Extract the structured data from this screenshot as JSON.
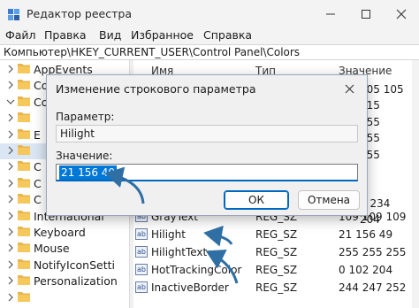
{
  "window": {
    "title": "Редактор реестра",
    "controls": [
      "minimize-icon",
      "maximize-icon",
      "close-icon"
    ]
  },
  "menu": [
    "Файл",
    "Правка",
    "Вид",
    "Избранное",
    "Справка"
  ],
  "address": "Компьютер\\HKEY_CURRENT_USER\\Control Panel\\Colors",
  "tree": [
    {
      "label": "AppEvents",
      "expanded": false
    },
    {
      "label": "Co",
      "expanded": false
    },
    {
      "label": "Co",
      "expanded": true
    },
    {
      "label": "",
      "expanded": false
    },
    {
      "label": "E",
      "expanded": false
    },
    {
      "label": "",
      "expanded": false,
      "selected": true
    },
    {
      "label": "C",
      "expanded": false
    },
    {
      "label": "C",
      "expanded": false
    },
    {
      "label": "C",
      "expanded": false
    },
    {
      "label": "International",
      "expanded": false
    },
    {
      "label": "Keyboard",
      "expanded": false
    },
    {
      "label": "Mouse",
      "expanded": false
    },
    {
      "label": "NotifyIconSetti",
      "expanded": false
    },
    {
      "label": "Personalization",
      "expanded": false
    },
    {
      "label": "",
      "expanded": false
    }
  ],
  "list": {
    "headers": {
      "name": "Имя",
      "type": "Тип",
      "value": "Значение"
    },
    "right_values": [
      "105 105",
      "215",
      "255",
      "255",
      "255",
      "",
      "",
      "9 234",
      "204"
    ],
    "rows": [
      {
        "name": "GrayText",
        "type": "REG_SZ",
        "value": "109 109 109"
      },
      {
        "name": "Hilight",
        "type": "REG_SZ",
        "value": "21 156 49"
      },
      {
        "name": "HilightText",
        "type": "REG_SZ",
        "value": "255 255 255"
      },
      {
        "name": "HotTrackingColor",
        "type": "REG_SZ",
        "value": "0 102 204"
      },
      {
        "name": "InactiveBorder",
        "type": "REG_SZ",
        "value": "244 247 252"
      }
    ]
  },
  "dialog": {
    "title": "Изменение строкового параметра",
    "param_label": "Параметр:",
    "param_value": "Hilight",
    "value_label": "Значение:",
    "value": "21 156 49",
    "ok_label": "ОК",
    "cancel_label": "Отмена"
  },
  "colors": {
    "accent": "#0067c0",
    "selection": "#0078d7",
    "folder": "#e9b44c",
    "annotation_arrow": "#2f6fa3"
  }
}
